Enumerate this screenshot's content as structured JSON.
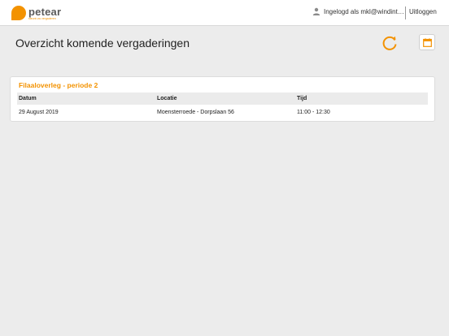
{
  "brand": {
    "name": "petear",
    "tagline": "steunt uw vergaderen",
    "accent_color": "#f39200"
  },
  "header": {
    "user_icon": "user-icon",
    "user_label": "Ingelogd als mkl@windint…",
    "logout_label": "Uitloggen"
  },
  "page": {
    "title": "Overzicht komende vergaderingen",
    "refresh_icon": "refresh-icon",
    "calendar_icon": "calendar-icon"
  },
  "meetings": [
    {
      "title": "Filaaloverleg - periode 2",
      "columns": [
        "Datum",
        "Locatie",
        "Tijd"
      ],
      "rows": [
        {
          "date": "29 August 2019",
          "location": "Moensterroede - Dorpslaan 56",
          "time": "11:00 - 12:30"
        }
      ]
    }
  ]
}
